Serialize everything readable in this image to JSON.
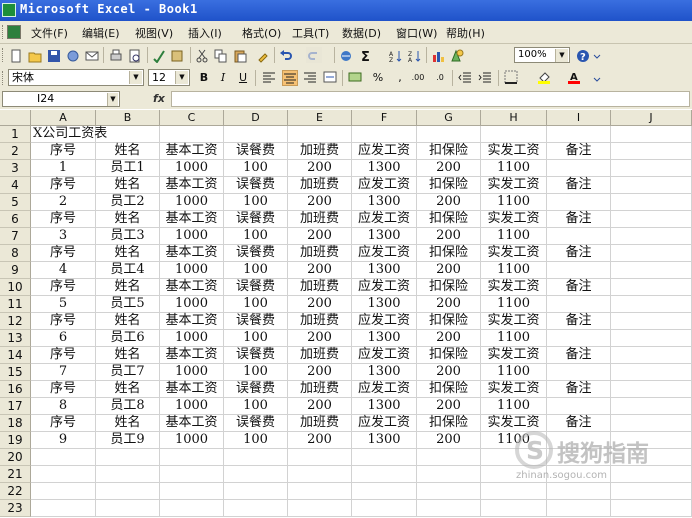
{
  "window": {
    "title": "Microsoft Excel - Book1"
  },
  "menu": [
    {
      "label": "文件(F)"
    },
    {
      "label": "编辑(E)"
    },
    {
      "label": "视图(V)"
    },
    {
      "label": "插入(I)"
    },
    {
      "label": "格式(O)"
    },
    {
      "label": "工具(T)"
    },
    {
      "label": "数据(D)"
    },
    {
      "label": "窗口(W)"
    },
    {
      "label": "帮助(H)"
    }
  ],
  "toolbar": {
    "zoom": "100%"
  },
  "formatting": {
    "font": "宋体",
    "size": "12"
  },
  "formula": {
    "name_box": "I24",
    "fx": "fx",
    "value": ""
  },
  "grid": {
    "columns": [
      "A",
      "B",
      "C",
      "D",
      "E",
      "F",
      "G",
      "H",
      "I",
      "J"
    ],
    "rows": [
      "1",
      "2",
      "3",
      "4",
      "5",
      "6",
      "7",
      "8",
      "9",
      "10",
      "11",
      "12",
      "13",
      "14",
      "15",
      "16",
      "17",
      "18",
      "19",
      "20",
      "21",
      "22",
      "23"
    ],
    "title": "X公司工资表",
    "header": [
      "序号",
      "姓名",
      "基本工资",
      "误餐费",
      "加班费",
      "应发工资",
      "扣保险",
      "实发工资",
      "备注"
    ],
    "records": [
      [
        "1",
        "员工1",
        "1000",
        "100",
        "200",
        "1300",
        "200",
        "1100",
        ""
      ],
      [
        "2",
        "员工2",
        "1000",
        "100",
        "200",
        "1300",
        "200",
        "1100",
        ""
      ],
      [
        "3",
        "员工3",
        "1000",
        "100",
        "200",
        "1300",
        "200",
        "1100",
        ""
      ],
      [
        "4",
        "员工4",
        "1000",
        "100",
        "200",
        "1300",
        "200",
        "1100",
        ""
      ],
      [
        "5",
        "员工5",
        "1000",
        "100",
        "200",
        "1300",
        "200",
        "1100",
        ""
      ],
      [
        "6",
        "员工6",
        "1000",
        "100",
        "200",
        "1300",
        "200",
        "1100",
        ""
      ],
      [
        "7",
        "员工7",
        "1000",
        "100",
        "200",
        "1300",
        "200",
        "1100",
        ""
      ],
      [
        "8",
        "员工8",
        "1000",
        "100",
        "200",
        "1300",
        "200",
        "1100",
        ""
      ],
      [
        "9",
        "员工9",
        "1000",
        "100",
        "200",
        "1300",
        "200",
        "1100",
        ""
      ]
    ]
  },
  "watermark": {
    "text": "搜狗指南",
    "url": "zhinan.sogou.com"
  }
}
